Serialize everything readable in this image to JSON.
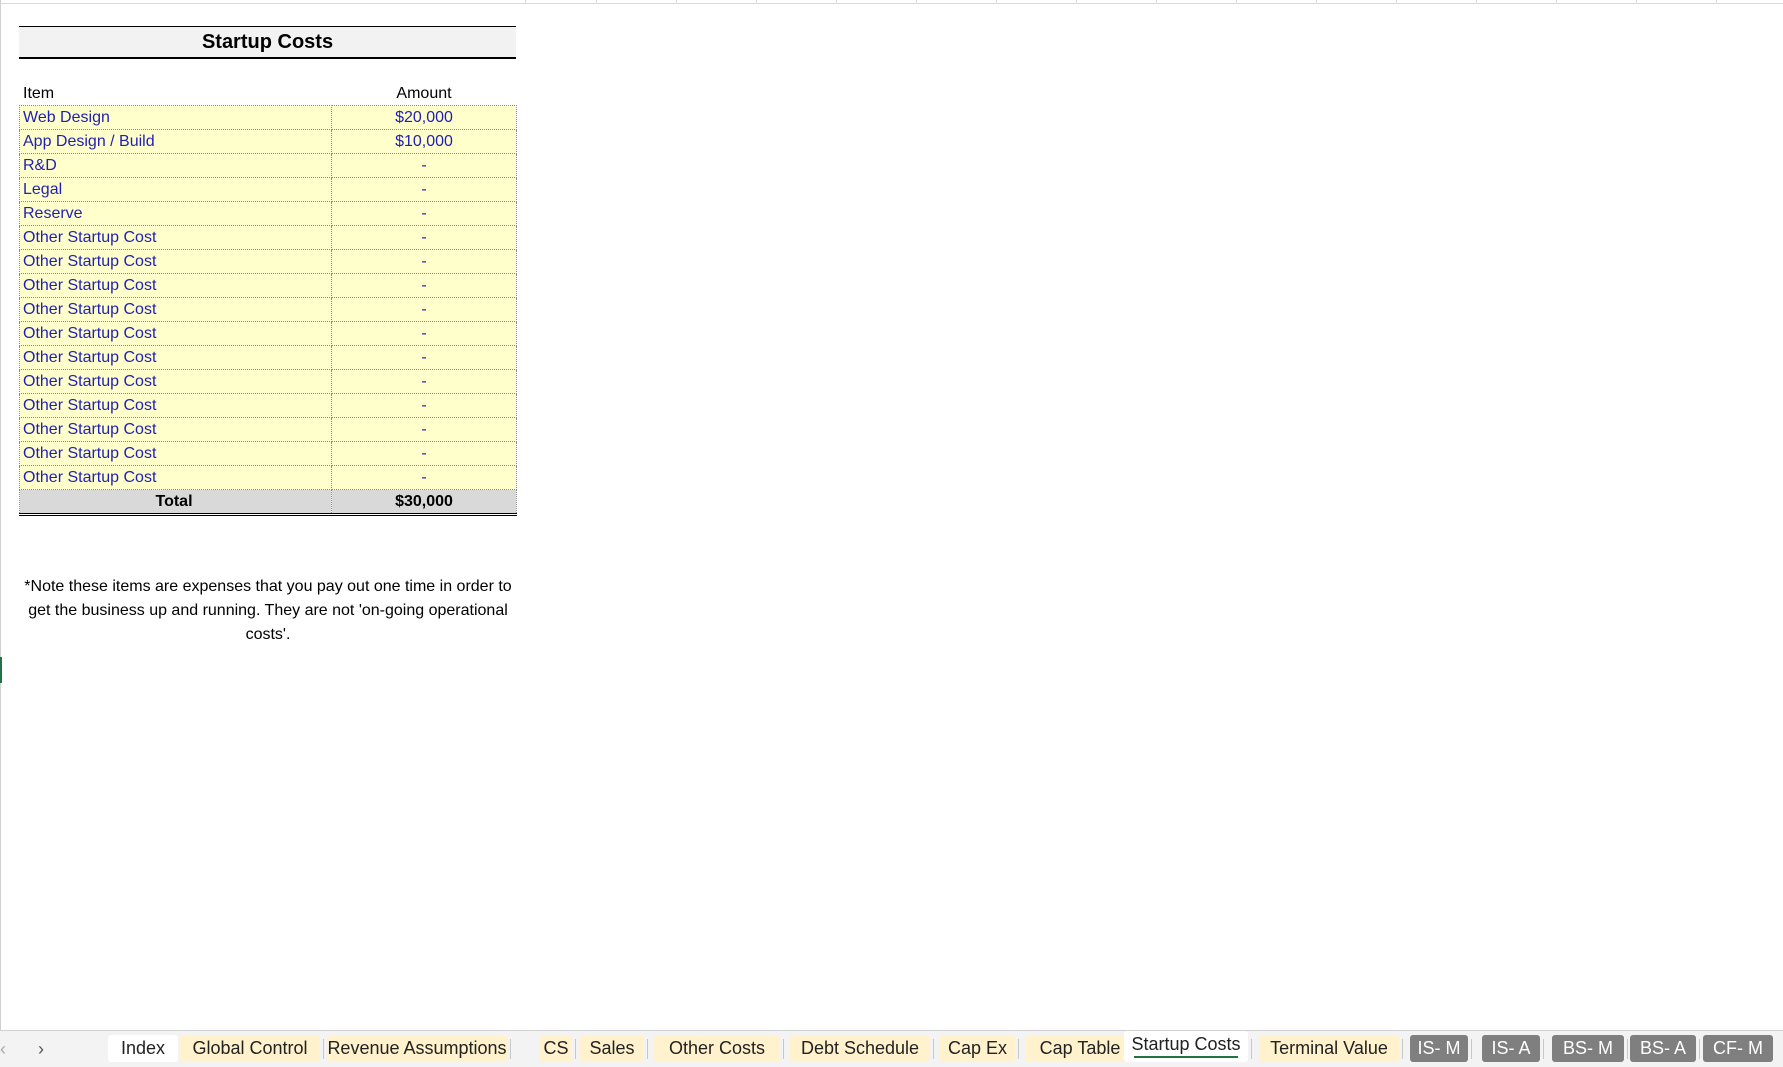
{
  "sheet": {
    "title": "Startup Costs",
    "headers": {
      "item": "Item",
      "amount": "Amount"
    },
    "rows": [
      {
        "item": "Web Design",
        "amount": "$20,000"
      },
      {
        "item": "App Design / Build",
        "amount": "$10,000"
      },
      {
        "item": "R&D",
        "amount": "-"
      },
      {
        "item": "Legal",
        "amount": "-"
      },
      {
        "item": "Reserve",
        "amount": "-"
      },
      {
        "item": "Other Startup Cost",
        "amount": "-"
      },
      {
        "item": "Other Startup Cost",
        "amount": "-"
      },
      {
        "item": "Other Startup Cost",
        "amount": "-"
      },
      {
        "item": "Other Startup Cost",
        "amount": "-"
      },
      {
        "item": "Other Startup Cost",
        "amount": "-"
      },
      {
        "item": "Other Startup Cost",
        "amount": "-"
      },
      {
        "item": "Other Startup Cost",
        "amount": "-"
      },
      {
        "item": "Other Startup Cost",
        "amount": "-"
      },
      {
        "item": "Other Startup Cost",
        "amount": "-"
      },
      {
        "item": "Other Startup Cost",
        "amount": "-"
      },
      {
        "item": "Other Startup Cost",
        "amount": "-"
      }
    ],
    "total": {
      "label": "Total",
      "amount": "$30,000"
    },
    "note": "*Note these items are expenses that you pay out one time in order to get the business up and running. They are not 'on-going operational costs'."
  },
  "tabbar": {
    "prev_icon": "chevron-left-icon",
    "next_icon": "chevron-right-icon",
    "tabs": [
      {
        "label": "Index",
        "style": "white"
      },
      {
        "label": "Global Control",
        "style": "yellow"
      },
      {
        "label": "Revenue Assumptions",
        "style": "yellow"
      },
      {
        "label": "CS",
        "style": "yellow"
      },
      {
        "label": "Sales",
        "style": "yellow"
      },
      {
        "label": "Other Costs",
        "style": "yellow"
      },
      {
        "label": "Debt Schedule",
        "style": "yellow"
      },
      {
        "label": "Cap Ex",
        "style": "yellow"
      },
      {
        "label": "Cap Table",
        "style": "yellow"
      },
      {
        "label": "Startup Costs",
        "style": "active"
      },
      {
        "label": "Terminal Value",
        "style": "yellow"
      },
      {
        "label": "IS- M",
        "style": "dark"
      },
      {
        "label": "IS- A",
        "style": "dark"
      },
      {
        "label": "BS- M",
        "style": "dark"
      },
      {
        "label": "BS- A",
        "style": "dark"
      },
      {
        "label": "CF- M",
        "style": "dark"
      }
    ]
  },
  "colors": {
    "input_fill": "#ffffcc",
    "input_text": "#1f1fb4",
    "total_fill": "#d9d9d9",
    "tab_yellow": "#fff2cc",
    "tab_dark": "#7f7f7f",
    "active_underline": "#217346"
  }
}
